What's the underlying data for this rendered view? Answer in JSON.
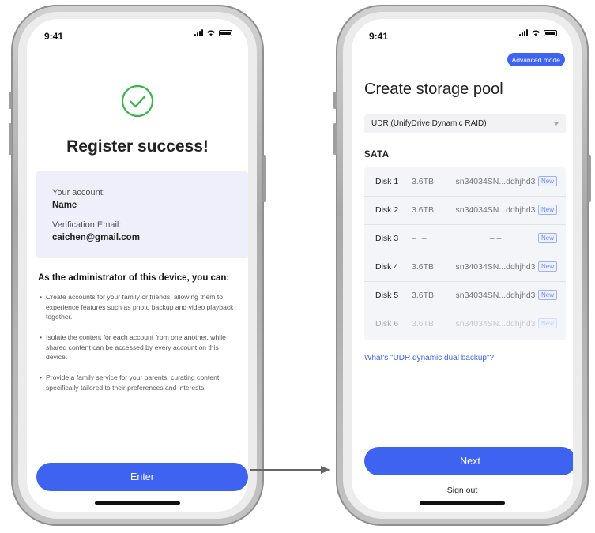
{
  "status_bar": {
    "time": "9:41"
  },
  "register": {
    "title": "Register success!",
    "account_label": "Your account:",
    "account_value": "Name",
    "email_label": "Verification Email:",
    "email_value": "caichen@gmail.com",
    "admin_heading": "As the administrator of this device, you can:",
    "bullets": [
      "Create accounts for your family or friends, allowing them to experience features such as photo backup and video playback together.",
      "Isolate the content for each account from one another, while shared content can be accessed by every account on this device.",
      "Provide a family service for your parents, curating content specifically tailored to their preferences and interests."
    ],
    "enter_label": "Enter"
  },
  "storage_pool": {
    "advanced_mode_label": "Advanced mode",
    "title": "Create storage pool",
    "raid_selected": "UDR (UnifyDrive Dynamic RAID)",
    "section_label": "SATA",
    "disks": [
      {
        "name": "Disk 1",
        "size": "3.6TB",
        "serial": "sn34034SN...ddhjhd3",
        "badge": "New"
      },
      {
        "name": "Disk 2",
        "size": "3.6TB",
        "serial": "sn34034SN...ddhjhd3",
        "badge": "New"
      },
      {
        "name": "Disk 3",
        "size": "– –",
        "serial": "– –",
        "badge": "New"
      },
      {
        "name": "Disk 4",
        "size": "3.6TB",
        "serial": "sn34034SN...ddhjhd3",
        "badge": "New"
      },
      {
        "name": "Disk 5",
        "size": "3.6TB",
        "serial": "sn34034SN...ddhjhd3",
        "badge": "New"
      },
      {
        "name": "Disk 6",
        "size": "3.6TB",
        "serial": "sn34034SN...ddhjhd3",
        "badge": "New"
      }
    ],
    "backup_link": "What's \"UDR dynamic dual backup\"?",
    "next_label": "Next",
    "signout_label": "Sign out"
  },
  "colors": {
    "accent": "#3d63f0",
    "success": "#3bb54a",
    "card_bg": "#eeeffa"
  },
  "icons": [
    "success-check-icon",
    "signal-icon",
    "wifi-icon",
    "battery-icon",
    "dropdown-caret-icon",
    "flow-arrow-icon"
  ]
}
